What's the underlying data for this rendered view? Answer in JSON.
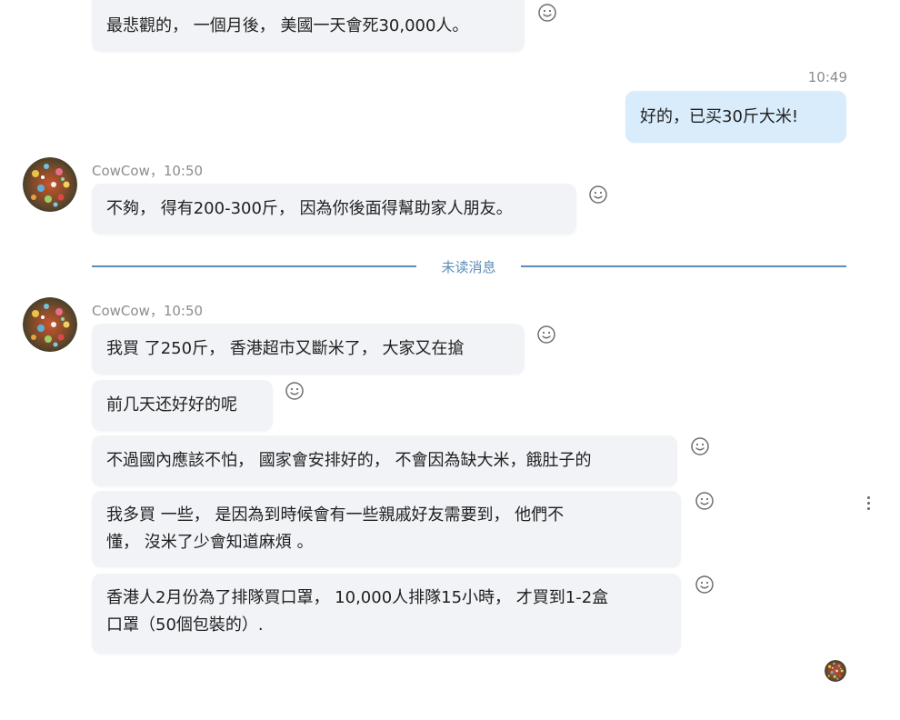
{
  "messages_top": {
    "msg0": "最悲觀的， 一個月後， 美國一天會死30,000人。"
  },
  "self": {
    "time": "10:49",
    "text": "好的，已买30斤大米!"
  },
  "group1": {
    "meta": "CowCow，10:50",
    "text": "不夠， 得有200-300斤， 因為你後面得幫助家人朋友。"
  },
  "divider": {
    "label": "未读消息"
  },
  "group2": {
    "meta": "CowCow，10:50",
    "m1": "我買 了250斤， 香港超市又斷米了， 大家又在搶",
    "m2": "前几天还好好的呢",
    "m3": "不過國內應該不怕， 國家會安排好的， 不會因為缺大米，餓肚子的",
    "m4_line1": "我多買 一些， 是因為到時候會有一些親戚好友需要到， 他們不",
    "m4_line2": "懂， 沒米了少會知道麻煩 。",
    "m5_line1": "香港人2月份為了排隊買口罩， 10,000人排隊15小時， 才買到1-2盒",
    "m5_line2": "口罩（50個包裝的）."
  },
  "icons": {
    "react": "smiley-icon",
    "more": "more-vertical-icon"
  },
  "colors": {
    "bubble_other": "#f1f3f7",
    "bubble_self": "#d9ecfb",
    "divider": "#5b8db8"
  }
}
